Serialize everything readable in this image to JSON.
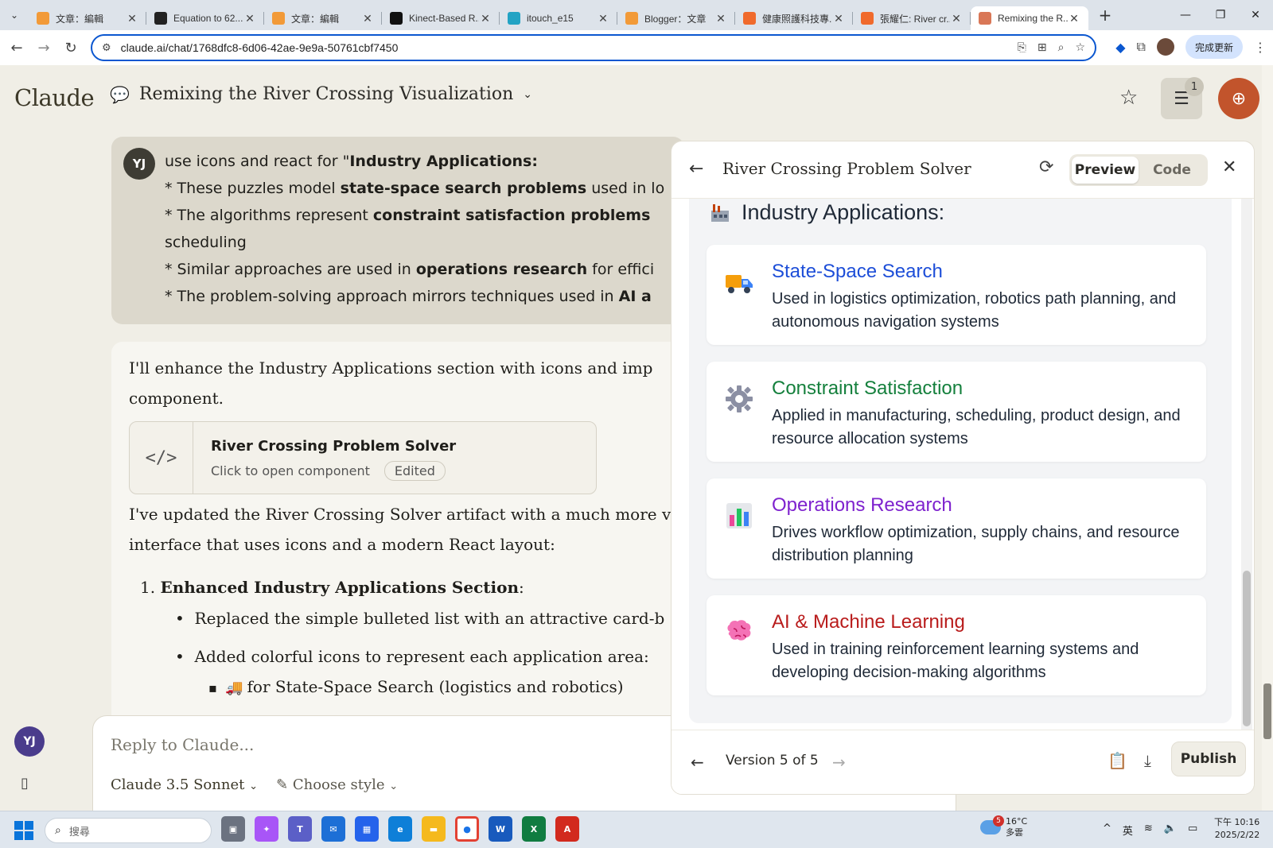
{
  "browser": {
    "tabs": [
      {
        "title": "文章：編輯",
        "favicon": "blogger-icon",
        "color": "#f29a38",
        "active": false
      },
      {
        "title": "Equation to 62...",
        "favicon": "openai-icon",
        "color": "#222222",
        "active": false
      },
      {
        "title": "文章：編輯",
        "favicon": "blogger-icon",
        "color": "#f29a38",
        "active": false
      },
      {
        "title": "Kinect-Based R...",
        "favicon": "x-icon",
        "color": "#111111",
        "active": false
      },
      {
        "title": "itouch_e15",
        "favicon": "a-icon",
        "color": "#22a3c4",
        "active": false
      },
      {
        "title": "Blogger：文章",
        "favicon": "blogger-icon",
        "color": "#f29a38",
        "active": false
      },
      {
        "title": "健康照護科技專...",
        "favicon": "blogger-icon",
        "color": "#f06a2c",
        "active": false
      },
      {
        "title": "張耀仁: River cr...",
        "favicon": "blogger-icon",
        "color": "#f06a2c",
        "active": false
      },
      {
        "title": "Remixing the R...",
        "favicon": "claude-icon",
        "color": "#d97757",
        "active": true
      }
    ],
    "url": "claude.ai/chat/1768dfc8-6d06-42ae-9e9a-50761cbf7450",
    "update_label": "完成更新"
  },
  "app": {
    "brand": "Claude",
    "conversation_title": "Remixing the River Crossing Visualization",
    "new_chat_badge": "1"
  },
  "user_message": {
    "avatar": "YJ",
    "lines": [
      {
        "pre": "use icons and react for \"",
        "bold": "Industry Applications:",
        "post": ""
      },
      {
        "pre": "* These puzzles model ",
        "bold": "state-space search problems",
        "post": " used in lo"
      },
      {
        "pre": "* The algorithms represent ",
        "bold": "constraint satisfaction problems",
        "post": ""
      },
      {
        "pre": "scheduling",
        "bold": "",
        "post": ""
      },
      {
        "pre": "* Similar approaches are used in ",
        "bold": "operations research",
        "post": " for effici"
      },
      {
        "pre": "* The problem-solving approach mirrors techniques used in ",
        "bold": "AI a",
        "post": ""
      }
    ]
  },
  "assistant": {
    "intro_line1": "I'll enhance the Industry Applications section with icons and imp",
    "intro_line2": "component.",
    "artifact_title": "River Crossing Problem Solver",
    "artifact_sub": "Click to open component",
    "artifact_badge": "Edited",
    "update_line1": "I've updated the River Crossing Solver artifact with a much more v",
    "update_line2": "interface that uses icons and a modern React layout:",
    "list_num": "1.",
    "list_bold": "Enhanced Industry Applications Section",
    "list_colon": ":",
    "bullet1": "Replaced the simple bulleted list with an attractive card-b",
    "bullet2": "Added colorful icons to represent each application area:",
    "sub_bullet": "for State-Space Search (logistics and robotics)"
  },
  "reply": {
    "placeholder": "Reply to Claude...",
    "model": "Claude 3.5 Sonnet",
    "style": "Choose style"
  },
  "sidebar": {
    "avatar": "YJ"
  },
  "panel": {
    "title": "River Crossing Problem Solver",
    "tab_preview": "Preview",
    "tab_code": "Code",
    "section_title": "Industry Applications:",
    "cards": [
      {
        "title": "State-Space Search",
        "desc": "Used in logistics optimization, robotics path planning, and autonomous navigation systems",
        "color": "#1d4ed8",
        "icon": "truck-icon"
      },
      {
        "title": "Constraint Satisfaction",
        "desc": "Applied in manufacturing, scheduling, product design, and resource allocation systems",
        "color": "#15803d",
        "icon": "gear-icon"
      },
      {
        "title": "Operations Research",
        "desc": "Drives workflow optimization, supply chains, and resource distribution planning",
        "color": "#7e22ce",
        "icon": "bar-chart-icon"
      },
      {
        "title": "AI & Machine Learning",
        "desc": "Used in training reinforcement learning systems and developing decision-making algorithms",
        "color": "#b91c1c",
        "icon": "brain-icon"
      }
    ],
    "version": "Version 5 of 5",
    "publish": "Publish"
  },
  "taskbar": {
    "search_placeholder": "搜尋",
    "weather_temp": "16°C",
    "weather_desc": "多雲",
    "weather_badge": "5",
    "ime": "英",
    "time": "下午 10:16",
    "date": "2025/2/22"
  }
}
